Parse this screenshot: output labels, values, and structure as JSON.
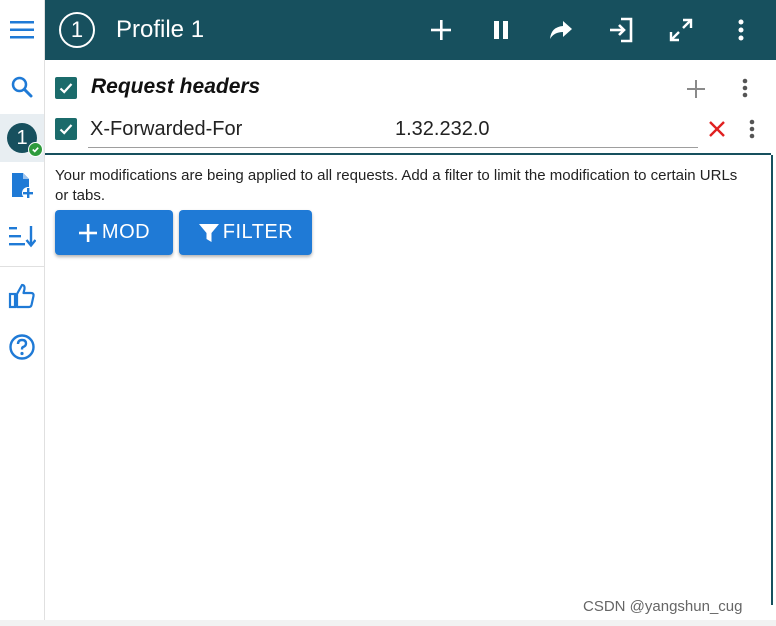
{
  "sidebar": {
    "menu_icon": "hamburger-menu-icon",
    "search_icon": "search-icon",
    "profile_badge": "1",
    "add_profile_icon": "add-file-icon",
    "sort_icon": "sort-icon",
    "like_icon": "thumbs-up-icon",
    "help_icon": "help-icon"
  },
  "header": {
    "profile_number": "1",
    "title": "Profile 1",
    "background": "#17505e"
  },
  "section": {
    "title": "Request headers",
    "checked": true
  },
  "modifier": {
    "checked": true,
    "name": "X-Forwarded-For",
    "value": "1.32.232.0"
  },
  "info_text": "Your modifications are being applied to all requests. Add a filter to limit the modification to certain URLs or tabs.",
  "buttons": {
    "mod_label": "MOD",
    "filter_label": "FILTER",
    "color": "#1f7ad6"
  },
  "watermark": "CSDN @yangshun_cug"
}
